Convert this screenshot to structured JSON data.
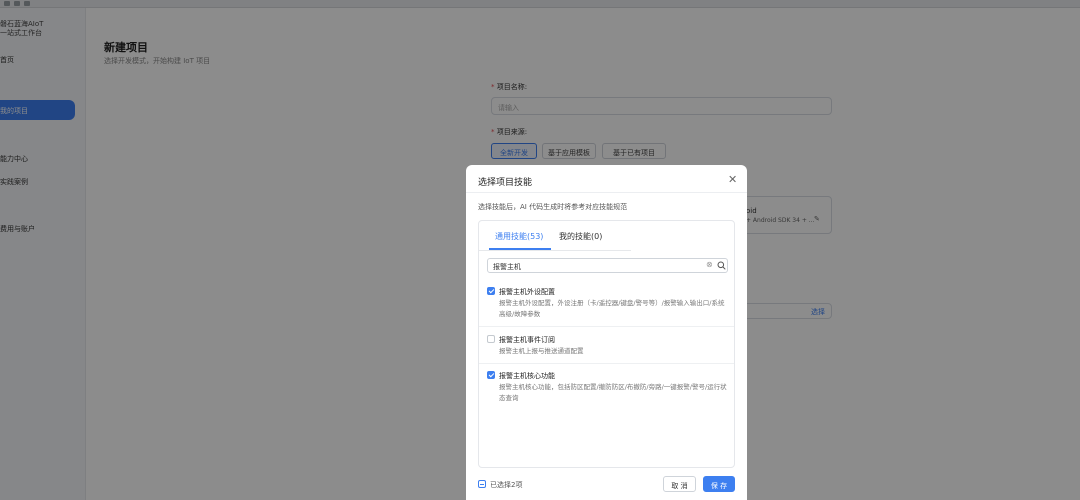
{
  "sidebar": {
    "brand_line1": "磐石蓝海AIoT",
    "brand_line2": "一站式工作台",
    "items": [
      {
        "label": "首页"
      },
      {
        "label": "我的项目"
      },
      {
        "label": "能力中心"
      },
      {
        "label": "实践案例"
      },
      {
        "label": "费用与账户"
      }
    ],
    "collapse_icon": "‹"
  },
  "page": {
    "title": "新建项目",
    "subtitle": "选择开发模式，开始构建 IoT 项目",
    "name_label": "项目名称:",
    "name_placeholder": "请输入",
    "source_label": "项目来源:",
    "source_options": [
      "全新开发",
      "基于应用模板",
      "基于已有项目"
    ],
    "selected_source": "全新开发",
    "card_title": "oid",
    "card_subtitle": "+ Android SDK 34 + ...",
    "field_action": "选择"
  },
  "modal": {
    "title": "选择项目技能",
    "description": "选择技能后，AI 代码生成时将参考对应技能规范",
    "tabs": [
      {
        "label": "通用技能(53)",
        "active": true
      },
      {
        "label": "我的技能(0)",
        "active": false
      }
    ],
    "search": {
      "value": "报警主机"
    },
    "skills": [
      {
        "name": "报警主机外设配置",
        "checked": true,
        "description": "报警主机外设配置，外设注册（卡/遥控器/键盘/警号等）/报警输入输出口/系统高级/故障参数"
      },
      {
        "name": "报警主机事件订阅",
        "checked": false,
        "description": "报警主机上报与推送通道配置"
      },
      {
        "name": "报警主机核心功能",
        "checked": true,
        "description": "报警主机核心功能，包括防区配置/撤防防区/布撤防/旁路/一键报警/警号/运行状态查询"
      }
    ],
    "selected_count_text": "已选择2项",
    "cancel_label": "取 消",
    "save_label": "保 存"
  },
  "colors": {
    "accent": "#3d7ff0",
    "overlay": "rgba(0,0,0,0.45)",
    "required": "#e5484d"
  }
}
